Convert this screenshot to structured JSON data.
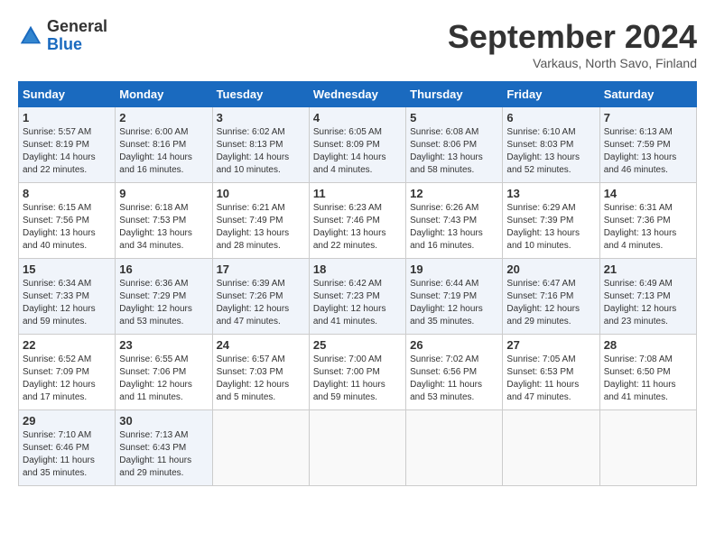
{
  "logo": {
    "general": "General",
    "blue": "Blue"
  },
  "title": "September 2024",
  "subtitle": "Varkaus, North Savo, Finland",
  "days_of_week": [
    "Sunday",
    "Monday",
    "Tuesday",
    "Wednesday",
    "Thursday",
    "Friday",
    "Saturday"
  ],
  "weeks": [
    [
      {
        "day": 1,
        "lines": [
          "Sunrise: 5:57 AM",
          "Sunset: 8:19 PM",
          "Daylight: 14 hours",
          "and 22 minutes."
        ]
      },
      {
        "day": 2,
        "lines": [
          "Sunrise: 6:00 AM",
          "Sunset: 8:16 PM",
          "Daylight: 14 hours",
          "and 16 minutes."
        ]
      },
      {
        "day": 3,
        "lines": [
          "Sunrise: 6:02 AM",
          "Sunset: 8:13 PM",
          "Daylight: 14 hours",
          "and 10 minutes."
        ]
      },
      {
        "day": 4,
        "lines": [
          "Sunrise: 6:05 AM",
          "Sunset: 8:09 PM",
          "Daylight: 14 hours",
          "and 4 minutes."
        ]
      },
      {
        "day": 5,
        "lines": [
          "Sunrise: 6:08 AM",
          "Sunset: 8:06 PM",
          "Daylight: 13 hours",
          "and 58 minutes."
        ]
      },
      {
        "day": 6,
        "lines": [
          "Sunrise: 6:10 AM",
          "Sunset: 8:03 PM",
          "Daylight: 13 hours",
          "and 52 minutes."
        ]
      },
      {
        "day": 7,
        "lines": [
          "Sunrise: 6:13 AM",
          "Sunset: 7:59 PM",
          "Daylight: 13 hours",
          "and 46 minutes."
        ]
      }
    ],
    [
      {
        "day": 8,
        "lines": [
          "Sunrise: 6:15 AM",
          "Sunset: 7:56 PM",
          "Daylight: 13 hours",
          "and 40 minutes."
        ]
      },
      {
        "day": 9,
        "lines": [
          "Sunrise: 6:18 AM",
          "Sunset: 7:53 PM",
          "Daylight: 13 hours",
          "and 34 minutes."
        ]
      },
      {
        "day": 10,
        "lines": [
          "Sunrise: 6:21 AM",
          "Sunset: 7:49 PM",
          "Daylight: 13 hours",
          "and 28 minutes."
        ]
      },
      {
        "day": 11,
        "lines": [
          "Sunrise: 6:23 AM",
          "Sunset: 7:46 PM",
          "Daylight: 13 hours",
          "and 22 minutes."
        ]
      },
      {
        "day": 12,
        "lines": [
          "Sunrise: 6:26 AM",
          "Sunset: 7:43 PM",
          "Daylight: 13 hours",
          "and 16 minutes."
        ]
      },
      {
        "day": 13,
        "lines": [
          "Sunrise: 6:29 AM",
          "Sunset: 7:39 PM",
          "Daylight: 13 hours",
          "and 10 minutes."
        ]
      },
      {
        "day": 14,
        "lines": [
          "Sunrise: 6:31 AM",
          "Sunset: 7:36 PM",
          "Daylight: 13 hours",
          "and 4 minutes."
        ]
      }
    ],
    [
      {
        "day": 15,
        "lines": [
          "Sunrise: 6:34 AM",
          "Sunset: 7:33 PM",
          "Daylight: 12 hours",
          "and 59 minutes."
        ]
      },
      {
        "day": 16,
        "lines": [
          "Sunrise: 6:36 AM",
          "Sunset: 7:29 PM",
          "Daylight: 12 hours",
          "and 53 minutes."
        ]
      },
      {
        "day": 17,
        "lines": [
          "Sunrise: 6:39 AM",
          "Sunset: 7:26 PM",
          "Daylight: 12 hours",
          "and 47 minutes."
        ]
      },
      {
        "day": 18,
        "lines": [
          "Sunrise: 6:42 AM",
          "Sunset: 7:23 PM",
          "Daylight: 12 hours",
          "and 41 minutes."
        ]
      },
      {
        "day": 19,
        "lines": [
          "Sunrise: 6:44 AM",
          "Sunset: 7:19 PM",
          "Daylight: 12 hours",
          "and 35 minutes."
        ]
      },
      {
        "day": 20,
        "lines": [
          "Sunrise: 6:47 AM",
          "Sunset: 7:16 PM",
          "Daylight: 12 hours",
          "and 29 minutes."
        ]
      },
      {
        "day": 21,
        "lines": [
          "Sunrise: 6:49 AM",
          "Sunset: 7:13 PM",
          "Daylight: 12 hours",
          "and 23 minutes."
        ]
      }
    ],
    [
      {
        "day": 22,
        "lines": [
          "Sunrise: 6:52 AM",
          "Sunset: 7:09 PM",
          "Daylight: 12 hours",
          "and 17 minutes."
        ]
      },
      {
        "day": 23,
        "lines": [
          "Sunrise: 6:55 AM",
          "Sunset: 7:06 PM",
          "Daylight: 12 hours",
          "and 11 minutes."
        ]
      },
      {
        "day": 24,
        "lines": [
          "Sunrise: 6:57 AM",
          "Sunset: 7:03 PM",
          "Daylight: 12 hours",
          "and 5 minutes."
        ]
      },
      {
        "day": 25,
        "lines": [
          "Sunrise: 7:00 AM",
          "Sunset: 7:00 PM",
          "Daylight: 11 hours",
          "and 59 minutes."
        ]
      },
      {
        "day": 26,
        "lines": [
          "Sunrise: 7:02 AM",
          "Sunset: 6:56 PM",
          "Daylight: 11 hours",
          "and 53 minutes."
        ]
      },
      {
        "day": 27,
        "lines": [
          "Sunrise: 7:05 AM",
          "Sunset: 6:53 PM",
          "Daylight: 11 hours",
          "and 47 minutes."
        ]
      },
      {
        "day": 28,
        "lines": [
          "Sunrise: 7:08 AM",
          "Sunset: 6:50 PM",
          "Daylight: 11 hours",
          "and 41 minutes."
        ]
      }
    ],
    [
      {
        "day": 29,
        "lines": [
          "Sunrise: 7:10 AM",
          "Sunset: 6:46 PM",
          "Daylight: 11 hours",
          "and 35 minutes."
        ]
      },
      {
        "day": 30,
        "lines": [
          "Sunrise: 7:13 AM",
          "Sunset: 6:43 PM",
          "Daylight: 11 hours",
          "and 29 minutes."
        ]
      },
      null,
      null,
      null,
      null,
      null
    ]
  ]
}
